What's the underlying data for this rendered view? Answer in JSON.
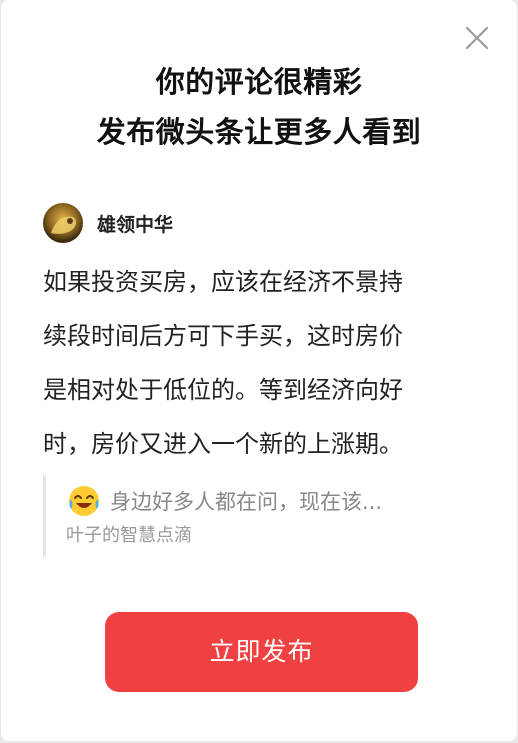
{
  "dialog": {
    "headline_line1": "你的评论很精彩",
    "headline_line2": "发布微头条让更多人看到"
  },
  "author": {
    "name": "雄领中华",
    "avatar_icon": "avatar-image"
  },
  "comment": {
    "lines": [
      "如果投资买房，应该在经济不景持",
      "续段时间后方可下手买，这时房价",
      "是相对处于低位的。等到经济向好",
      "时，房价又进入一个新的上涨期。"
    ]
  },
  "quote": {
    "emoji_icon": "laughing-crying-emoji-icon",
    "text": "身边好多人都在问，现在该...",
    "source": "叶子的智慧点滴"
  },
  "actions": {
    "publish_label": "立即发布",
    "close_icon": "close-icon"
  },
  "colors": {
    "accent": "#f04142",
    "text_primary": "#222222",
    "text_secondary": "#888888"
  }
}
